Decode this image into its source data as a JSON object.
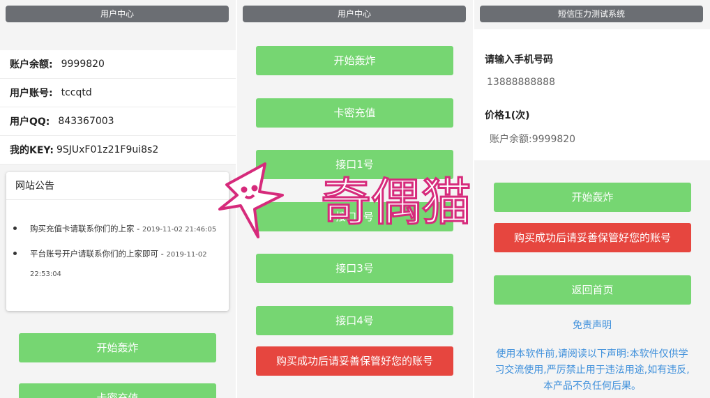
{
  "panel1": {
    "title": "用户中心",
    "rows": [
      {
        "key": "账户余额:",
        "value": "9999820"
      },
      {
        "key": "用户账号:",
        "value": "tccqtd"
      },
      {
        "key": "用户QQ:",
        "value": "843367003"
      },
      {
        "key": "我的KEY:",
        "value": "9SJUxF01z21F9ui8s2"
      }
    ],
    "notice": {
      "heading": "网站公告",
      "items": [
        {
          "text": "购买充值卡请联系你们的上家 - ",
          "time": "2019-11-02 21:46:05"
        },
        {
          "text": "平台账号开户请联系你们的上家即可 - ",
          "time": "2019-11-02 22:53:04"
        }
      ]
    },
    "buttons": {
      "start": "开始轰炸",
      "card": "卡密充值"
    }
  },
  "panel2": {
    "title": "用户中心",
    "buttons": [
      "开始轰炸",
      "卡密充值",
      "接口1号",
      "接口2号",
      "接口3号",
      "接口4号"
    ],
    "warning": "购买成功后请妥善保管好您的账号"
  },
  "panel3": {
    "title": "短信压力测试系统",
    "phone_label": "请输入手机号码",
    "phone_placeholder": "13888888888",
    "price_label": "价格1(次)",
    "balance_text": "账户余额:9999820",
    "start_button": "开始轰炸",
    "warning": "购买成功后请妥善保管好您的账号",
    "home_button": "返回首页",
    "disclaimer_link": "免责声明",
    "disclaimer_text": "使用本软件前,请阅读以下声明:本软件仅供学习交流使用,严厉禁止用于违法用途,如有违反,本产品不负任何后果。"
  },
  "watermark": {
    "text": "奇偶猫",
    "color": "#d62a7b"
  }
}
